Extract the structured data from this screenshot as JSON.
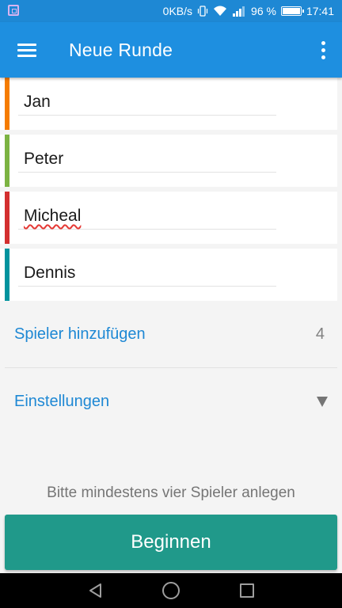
{
  "status_bar": {
    "network_speed": "0KB/s",
    "battery_percent": "96 %",
    "time": "17:41",
    "icons": [
      "gallery-notification-icon",
      "vibrate-icon",
      "wifi-icon",
      "signal-icon",
      "battery-icon"
    ]
  },
  "app_bar": {
    "title": "Neue Runde",
    "menu_icon": "hamburger-menu-icon",
    "overflow_icon": "more-vert-icon",
    "color": "#1e8fe0"
  },
  "players": [
    {
      "name": "Jan",
      "color": "#f57c00"
    },
    {
      "name": "Peter",
      "color": "#7cb342"
    },
    {
      "name": "Micheal",
      "color": "#d32f2f",
      "spell_error": true
    },
    {
      "name": "Dennis",
      "color": "#00939e"
    }
  ],
  "add_player": {
    "label": "Spieler hinzufügen",
    "count": "4"
  },
  "settings": {
    "label": "Einstellungen",
    "icon": "dropdown-arrow-icon"
  },
  "hint": "Bitte mindestens vier Spieler anlegen",
  "begin_button": {
    "label": "Beginnen",
    "color": "#20998a"
  },
  "nav_bar": {
    "icons": [
      "back-icon",
      "home-icon",
      "recent-apps-icon"
    ]
  }
}
